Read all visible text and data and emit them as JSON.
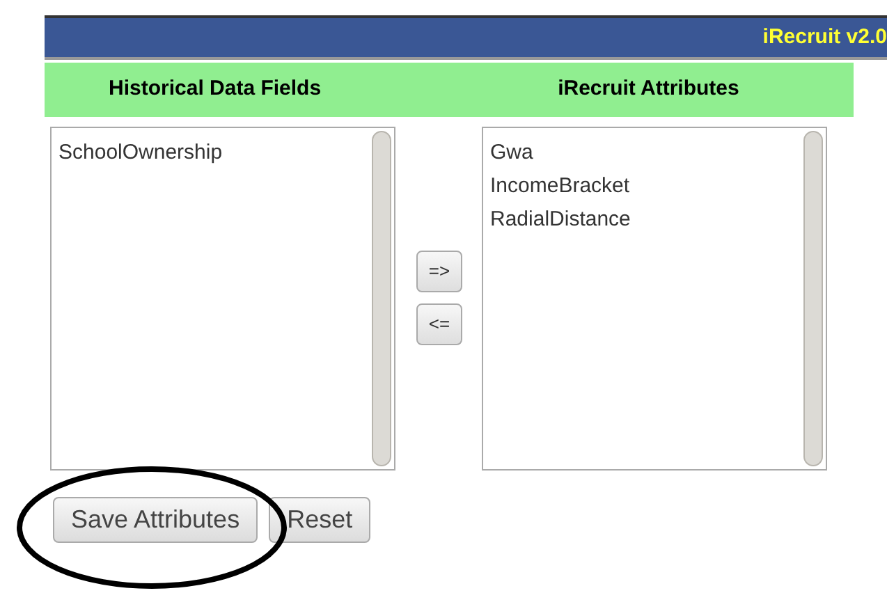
{
  "header": {
    "title": "iRecruit v2.0"
  },
  "columns": [
    "Historical Data Fields",
    "iRecruit Attributes"
  ],
  "historical_fields": [
    "SchoolOwnership"
  ],
  "irecruit_attributes": [
    "Gwa",
    "IncomeBracket",
    "RadialDistance"
  ],
  "move_buttons": [
    "=>",
    "<="
  ],
  "buttons": [
    "Save Attributes",
    "Reset"
  ],
  "annotation": {
    "kind": "ellipse"
  }
}
